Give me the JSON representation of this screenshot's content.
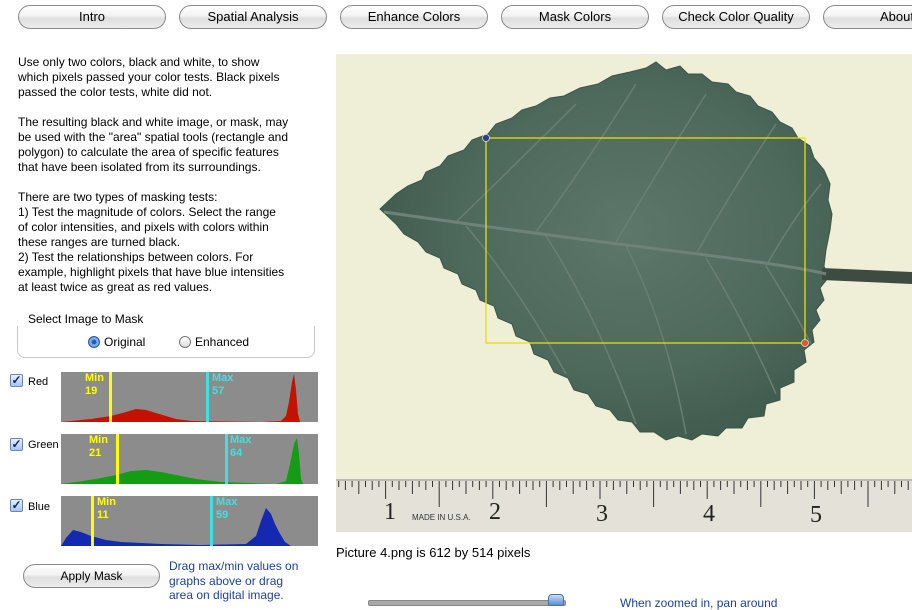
{
  "tabs": [
    {
      "label": "Intro"
    },
    {
      "label": "Spatial Analysis"
    },
    {
      "label": "Enhance Colors"
    },
    {
      "label": "Mask Colors"
    },
    {
      "label": "Check Color Quality"
    },
    {
      "label": "About"
    }
  ],
  "instructions": {
    "p1": [
      "Use only two colors, black and white, to show",
      "which pixels passed your color tests.  Black pixels",
      "passed the color tests, white did not."
    ],
    "p2": [
      "The resulting black and white image, or mask, may",
      "be used with the \"area\" spatial tools (rectangle and",
      "polygon) to calculate the area of specific features",
      "that have been isolated from its surroundings."
    ],
    "p3": [
      "There are two types of masking tests:",
      "1) Test the magnitude of colors.  Select the range",
      "of color intensities, and pixels with colors within",
      "these ranges are turned black.",
      "2) Test the relationships between colors.  For",
      "example, highlight pixels that have blue intensities",
      "at least twice as great as red values."
    ]
  },
  "image_select": {
    "label": "Select Image to Mask",
    "options": [
      {
        "label": "Original",
        "selected": true
      },
      {
        "label": "Enhanced",
        "selected": false
      }
    ]
  },
  "channels": [
    {
      "label": "Red",
      "checked": true,
      "min_label": "Min",
      "min": 19,
      "max_label": "Max",
      "max": 57,
      "color": "#ff1a00"
    },
    {
      "label": "Green",
      "checked": true,
      "min_label": "Min",
      "min": 21,
      "max_label": "Max",
      "max": 64,
      "color": "#1ad81a"
    },
    {
      "label": "Blue",
      "checked": true,
      "min_label": "Min",
      "min": 11,
      "max_label": "Max",
      "max": 59,
      "color": "#1a3cff"
    }
  ],
  "apply_button": "Apply Mask",
  "drag_hint": [
    "Drag max/min values on",
    "graphs above or drag",
    "area on digital image."
  ],
  "ruler_labels": [
    "1",
    "2",
    "3",
    "4",
    "5"
  ],
  "ruler_text": "MADE IN U.S.A.",
  "caption": "Picture 4.png is 612 by 514 pixels",
  "zoom_hint": "When zoomed in, pan around",
  "colors": {
    "min_marker": "#ffff00",
    "max_marker": "#40e0e0",
    "selection": "#e8e000",
    "link_text": "#1d3fa8"
  }
}
